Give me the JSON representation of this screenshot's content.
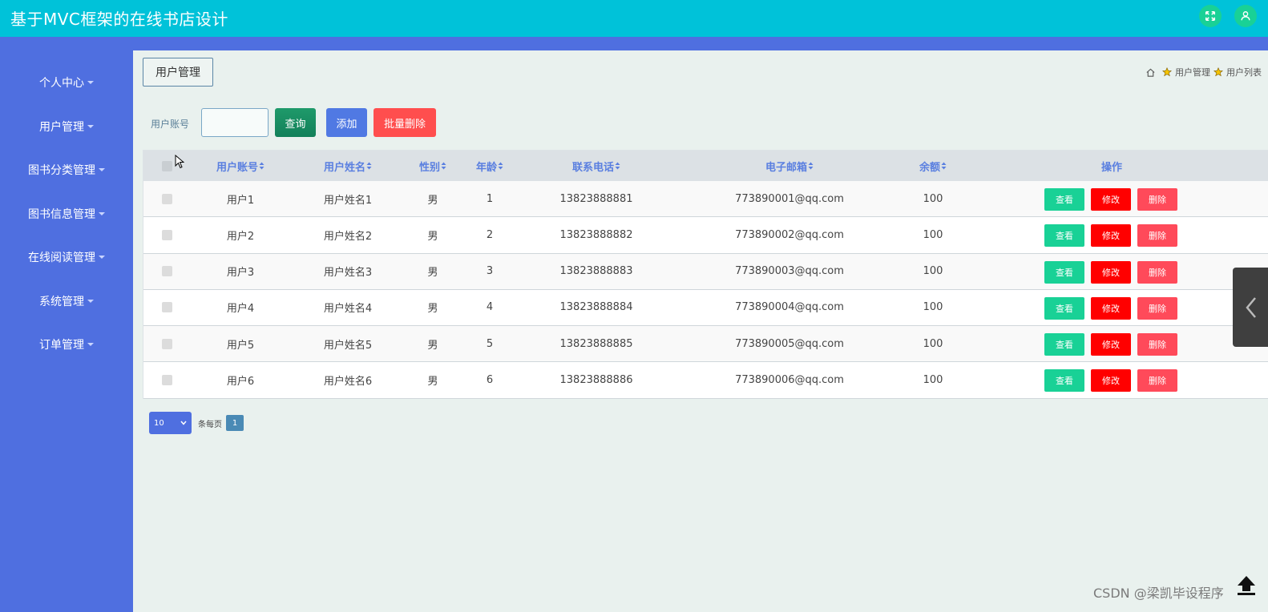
{
  "app": {
    "title": "基于MVC框架的在线书店设计"
  },
  "header": {
    "fullscreen_icon": "expand-icon",
    "user_icon": "user-icon"
  },
  "sidebar": {
    "items": [
      {
        "label": "个人中心"
      },
      {
        "label": "用户管理"
      },
      {
        "label": "图书分类管理"
      },
      {
        "label": "图书信息管理"
      },
      {
        "label": "在线阅读管理"
      },
      {
        "label": "系统管理"
      },
      {
        "label": "订单管理"
      }
    ]
  },
  "page": {
    "tab_label": "用户管理",
    "breadcrumb": [
      "用户管理",
      "用户列表"
    ]
  },
  "search": {
    "label": "用户账号",
    "value": "",
    "query_label": "查询",
    "add_label": "添加",
    "batch_delete_label": "批量删除"
  },
  "table": {
    "headers": [
      "用户账号",
      "用户姓名",
      "性别",
      "年龄",
      "联系电话",
      "电子邮箱",
      "余额",
      "操作"
    ],
    "rows": [
      {
        "account": "用户1",
        "name": "用户姓名1",
        "gender": "男",
        "age": "1",
        "phone": "13823888881",
        "email": "773890001@qq.com",
        "balance": "100"
      },
      {
        "account": "用户2",
        "name": "用户姓名2",
        "gender": "男",
        "age": "2",
        "phone": "13823888882",
        "email": "773890002@qq.com",
        "balance": "100"
      },
      {
        "account": "用户3",
        "name": "用户姓名3",
        "gender": "男",
        "age": "3",
        "phone": "13823888883",
        "email": "773890003@qq.com",
        "balance": "100"
      },
      {
        "account": "用户4",
        "name": "用户姓名4",
        "gender": "男",
        "age": "4",
        "phone": "13823888884",
        "email": "773890004@qq.com",
        "balance": "100"
      },
      {
        "account": "用户5",
        "name": "用户姓名5",
        "gender": "男",
        "age": "5",
        "phone": "13823888885",
        "email": "773890005@qq.com",
        "balance": "100"
      },
      {
        "account": "用户6",
        "name": "用户姓名6",
        "gender": "男",
        "age": "6",
        "phone": "13823888886",
        "email": "773890006@qq.com",
        "balance": "100"
      }
    ],
    "actions": {
      "view": "查看",
      "edit": "修改",
      "delete": "删除"
    }
  },
  "pager": {
    "page_size": "10",
    "page_size_label": "条每页",
    "current_page": "1"
  },
  "watermark": "CSDN @梁凯毕设程序",
  "colors": {
    "topbar": "#00c2d9",
    "sidebar": "#4f6fe0",
    "view": "#19d196",
    "edit": "#ff0000",
    "delete": "#ff4a5a"
  }
}
